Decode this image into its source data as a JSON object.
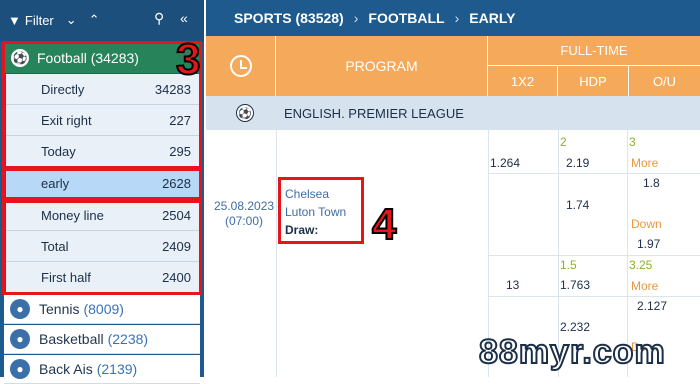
{
  "sidebar": {
    "filter_label": "Filter",
    "head": {
      "label": "Football (34283)"
    },
    "subs": [
      {
        "label": "Directly",
        "count": "34283"
      },
      {
        "label": "Exit right",
        "count": "227"
      },
      {
        "label": "Today",
        "count": "295"
      },
      {
        "label": "early",
        "count": "2628"
      },
      {
        "label": "Money line",
        "count": "2504"
      },
      {
        "label": "Total",
        "count": "2409"
      },
      {
        "label": "First half",
        "count": "2400"
      }
    ],
    "sports": [
      {
        "label": "Tennis",
        "count": "(8009)"
      },
      {
        "label": "Basketball",
        "count": "(2238)"
      },
      {
        "label": "Back Ais",
        "count": "(2139)"
      }
    ]
  },
  "annotations": {
    "num3": "3",
    "num4": "4"
  },
  "breadcrumb": {
    "a": "SPORTS (83528)",
    "b": "FOOTBALL",
    "c": "EARLY",
    "sep": "›"
  },
  "table": {
    "program": "PROGRAM",
    "fulltime": "FULL-TIME",
    "cols": [
      "1X2",
      "HDP",
      "O/U"
    ],
    "league": "ENGLISH. PREMIER LEAGUE"
  },
  "match": {
    "date": "25.08.2023",
    "time": "(07:00)",
    "home": "Chelsea",
    "away": "Luton Town",
    "draw": "Draw:"
  },
  "odds": {
    "x12_1": "1.264",
    "x12_2": "13",
    "hdp_1_line": "2",
    "hdp_1": "2.19",
    "hdp_2": "1.74",
    "hdp_3_line": "1.5",
    "hdp_3": "1.763",
    "hdp_4": "2.232",
    "ou_1_line": "3",
    "ou_1_label": "More",
    "ou_1": "1.8",
    "ou_2_label": "Down",
    "ou_2": "1.97",
    "ou_3_line": "3.25",
    "ou_3_label": "More",
    "ou_3": "2.127",
    "ou_4_label": "Down"
  },
  "watermark": "88myr.com"
}
